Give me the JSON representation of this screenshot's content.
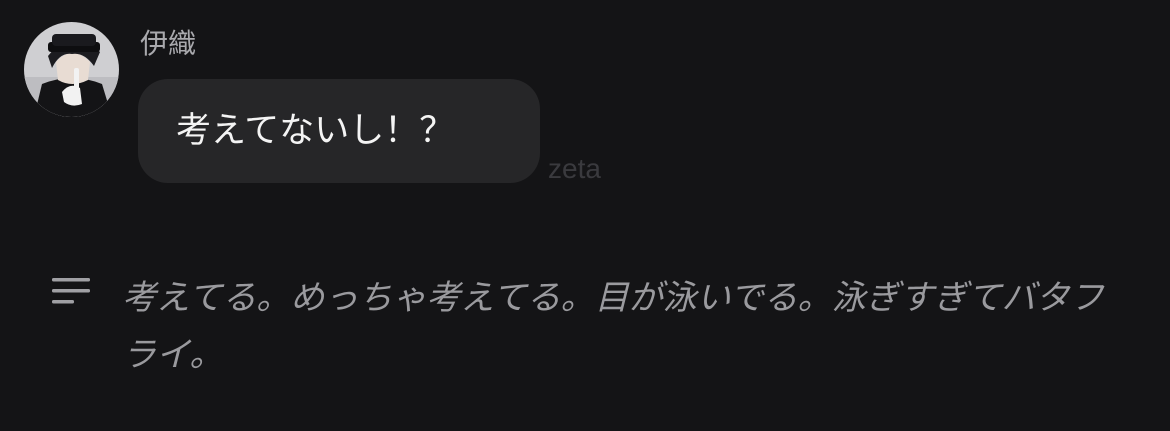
{
  "message": {
    "sender_name": "伊織",
    "text": "考えてないし！？",
    "watermark": "zeta"
  },
  "narration": {
    "icon": "text-lines-icon",
    "text": "考えてる。めっちゃ考えてる。目が泳いでる。泳ぎすぎてバタフライ。"
  },
  "colors": {
    "background": "#141416",
    "bubble": "#262628",
    "bubble_text": "#f4f4f4",
    "name_text": "#a9a9ad",
    "narration_text": "#9a9a9e"
  }
}
